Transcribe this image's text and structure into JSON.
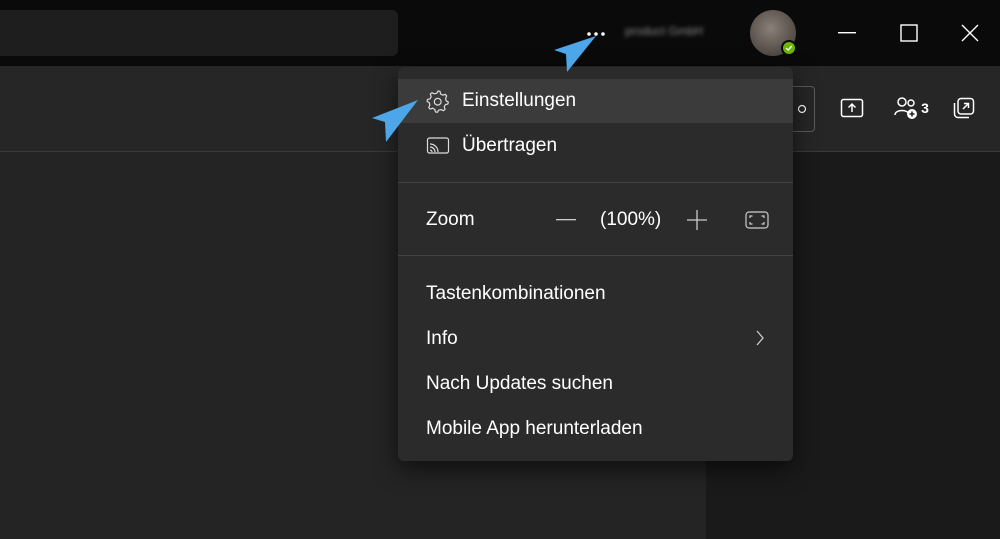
{
  "titlebar": {
    "org_name": "product GmbH",
    "icons": [
      "more-icon",
      "minimize-icon",
      "maximize-icon",
      "close-icon"
    ]
  },
  "toolbar": {
    "participants_count": "3",
    "icons": [
      "share-icon",
      "participants-icon",
      "popout-icon"
    ]
  },
  "menu": {
    "settings": "Einstellungen",
    "cast": "Übertragen",
    "zoom_label": "Zoom",
    "zoom_value": "(100%)",
    "shortcuts": "Tastenkombinationen",
    "info": "Info",
    "check_updates": "Nach Updates suchen",
    "mobile_app": "Mobile App herunterladen"
  },
  "colors": {
    "presence": "#6bb700",
    "pointer": "#4da6e8",
    "menu_bg": "#2b2b2b",
    "highlight": "#3b3b3b"
  }
}
